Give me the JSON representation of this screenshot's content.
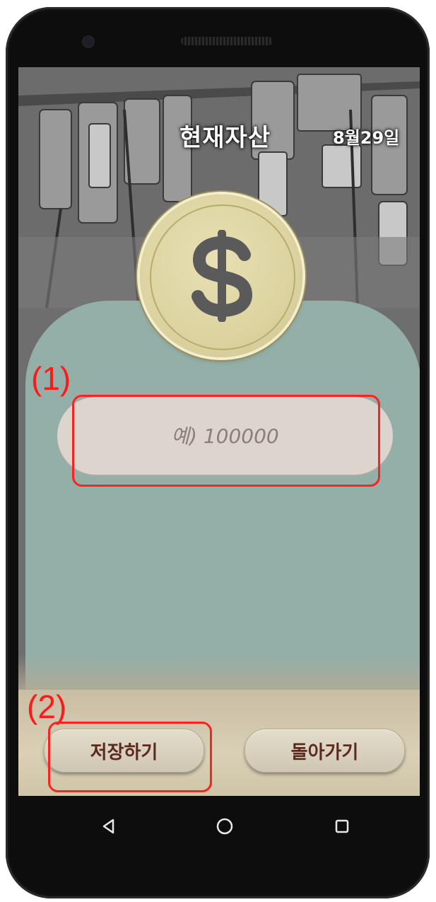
{
  "app": {
    "title": "현재자산",
    "date": "8월29일"
  },
  "input": {
    "placeholder": "예) 100000",
    "value": ""
  },
  "buttons": {
    "save_label": "저장하기",
    "back_label": "돌아가기"
  },
  "coin": {
    "icon": "dollar-sign-icon"
  },
  "navbar": {
    "back_icon": "back-triangle-icon",
    "home_icon": "home-circle-icon",
    "recents_icon": "recents-square-icon"
  },
  "annotations": {
    "label_1": "(1)",
    "label_2": "(2)"
  },
  "colors": {
    "panel": "#93afa8",
    "input_bg": "#ddd4cd",
    "button_text": "#5b2a1f",
    "annotation": "#ff2020"
  }
}
